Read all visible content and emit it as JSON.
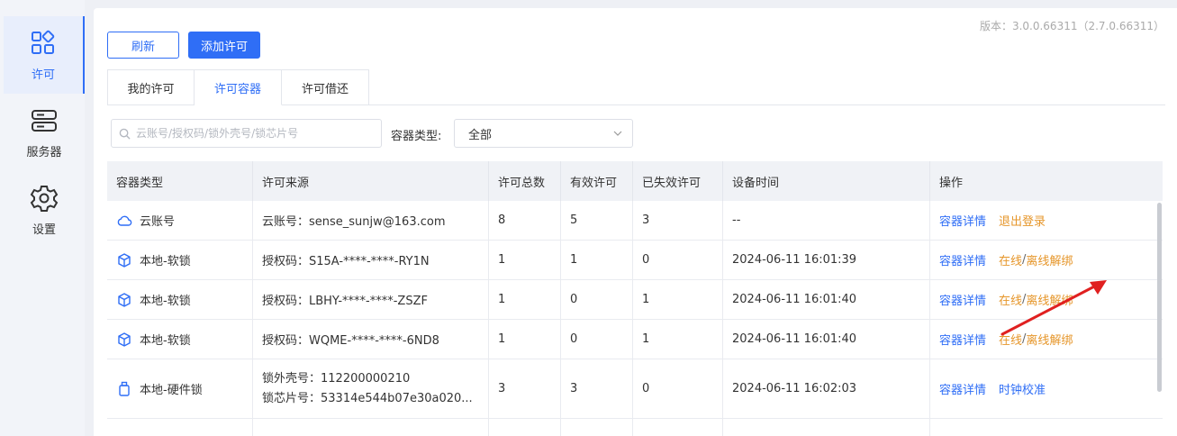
{
  "sidebar": {
    "items": [
      {
        "label": "许可",
        "icon": "grid-icon"
      },
      {
        "label": "服务器",
        "icon": "server-icon"
      },
      {
        "label": "设置",
        "icon": "gear-icon"
      }
    ]
  },
  "header": {
    "version": "版本：3.0.0.66311（2.7.0.66311）",
    "refresh_label": "刷新",
    "add_label": "添加许可"
  },
  "tabs": [
    {
      "label": "我的许可"
    },
    {
      "label": "许可容器"
    },
    {
      "label": "许可借还"
    }
  ],
  "filters": {
    "search_placeholder": "云账号/授权码/锁外壳号/锁芯片号",
    "type_label": "容器类型:",
    "type_value": "全部"
  },
  "table": {
    "headers": [
      "容器类型",
      "许可来源",
      "许可总数",
      "有效许可",
      "已失效许可",
      "设备时间",
      "操作"
    ],
    "rows": [
      {
        "type": "云账号",
        "icon": "cloud-icon",
        "source": "云账号：sense_sunjw@163.com",
        "total": "8",
        "valid": "5",
        "invalid": "3",
        "time": "--",
        "action1": "容器详情",
        "action2": "退出登录"
      },
      {
        "type": "本地-软锁",
        "icon": "cube-icon",
        "source": "授权码：S15A-****-****-RY1N",
        "total": "1",
        "valid": "1",
        "invalid": "0",
        "time": "2024-06-11 16:01:39",
        "action1": "容器详情",
        "online": "在线",
        "slash": "/",
        "offline": "离线",
        "unbind": "解绑"
      },
      {
        "type": "本地-软锁",
        "icon": "cube-icon",
        "source": "授权码：LBHY-****-****-ZSZF",
        "total": "1",
        "valid": "0",
        "invalid": "1",
        "time": "2024-06-11 16:01:40",
        "action1": "容器详情",
        "online": "在线",
        "slash": "/",
        "offline": "离线",
        "unbind": "解绑"
      },
      {
        "type": "本地-软锁",
        "icon": "cube-icon",
        "source": "授权码：WQME-****-****-6ND8",
        "total": "1",
        "valid": "0",
        "invalid": "1",
        "time": "2024-06-11 16:01:40",
        "action1": "容器详情",
        "online": "在线",
        "slash": "/",
        "offline": "离线",
        "unbind": "解绑"
      },
      {
        "type": "本地-硬件锁",
        "icon": "usb-key-icon",
        "source1": "锁外壳号：112200000210",
        "source2": "锁芯片号：53314e544b07e30a020...",
        "total": "3",
        "valid": "3",
        "invalid": "0",
        "time": "2024-06-11 16:02:03",
        "action1": "容器详情",
        "action2": "时钟校准"
      }
    ]
  },
  "colors": {
    "primary": "#2f6ef6",
    "warning": "#e6962a",
    "annotation_arrow": "#e02020"
  }
}
